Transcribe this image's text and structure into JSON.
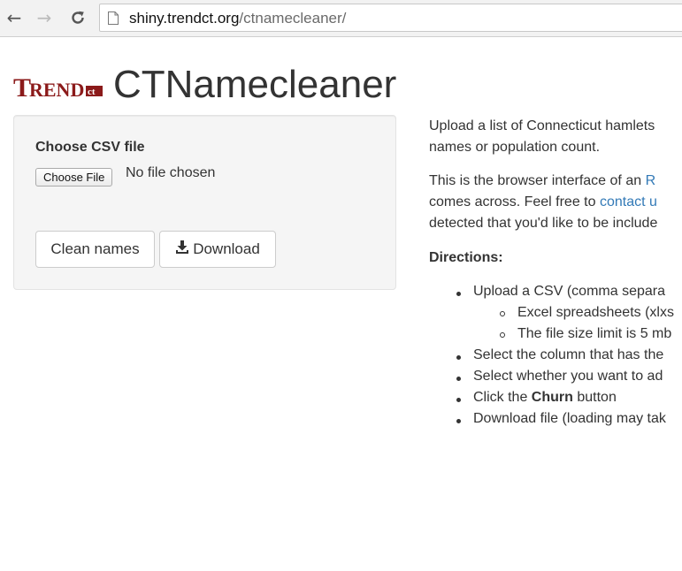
{
  "browser": {
    "url_host": "shiny.trendct.org",
    "url_path": "/ctnamecleaner/"
  },
  "header": {
    "logo_text": "TRENDct",
    "title": "CTNamecleaner"
  },
  "sidebar": {
    "file_label": "Choose CSV file",
    "file_button": "Choose File",
    "file_status": "No file chosen",
    "clean_button": "Clean names",
    "download_button": "Download"
  },
  "main": {
    "intro_line1": "Upload a list of Connecticut hamlets",
    "intro_line2": "names or population count.",
    "para_line1_before": "This is the browser interface of an ",
    "para_line1_link": "R",
    "para_line2_before": "comes across. Feel free to ",
    "para_line2_link": "contact u",
    "para_line3": "detected that you'd like to be include",
    "directions_label": "Directions:",
    "steps": [
      {
        "text": "Upload a CSV (comma separa",
        "sub": [
          "Excel spreadsheets (xlxs",
          "The file size limit is 5 mb"
        ]
      },
      {
        "text": "Select the column that has the"
      },
      {
        "text": "Select whether you want to ad"
      },
      {
        "text_before": "Click the ",
        "bold": "Churn",
        "text_after": " button"
      },
      {
        "text": "Download file (loading may tak"
      }
    ]
  },
  "colors": {
    "logo": "#8b1a1a",
    "link": "#337ab7",
    "well_bg": "#f5f5f5"
  }
}
